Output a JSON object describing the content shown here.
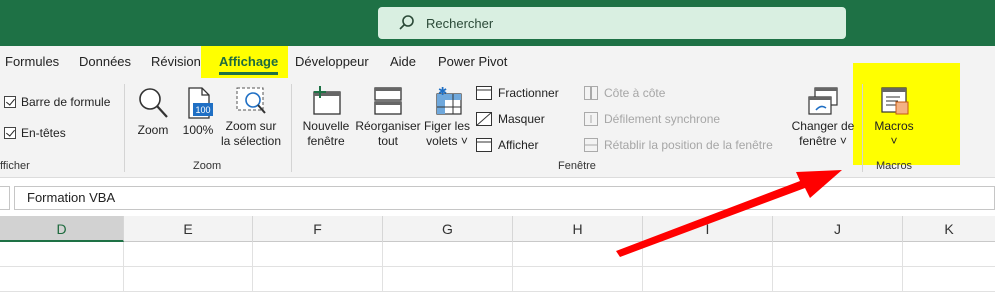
{
  "search": {
    "placeholder": "Rechercher"
  },
  "tabs": [
    {
      "label": "Formules"
    },
    {
      "label": "Données"
    },
    {
      "label": "Révision"
    },
    {
      "label": "Affichage"
    },
    {
      "label": "Développeur"
    },
    {
      "label": "Aide"
    },
    {
      "label": "Power Pivot"
    }
  ],
  "groups": {
    "show": {
      "label": "fficher",
      "formula_bar": "Barre de formule",
      "headings": "En-têtes"
    },
    "zoom": {
      "label": "Zoom",
      "zoom_btn": "Zoom",
      "zoom100_btn": "100%",
      "zoom100_icon_text": "100",
      "zoom_sel_l1": "Zoom sur",
      "zoom_sel_l2": "la sélection"
    },
    "window": {
      "label": "Fenêtre",
      "new_l1": "Nouvelle",
      "new_l2": "fenêtre",
      "arrange_l1": "Réorganiser",
      "arrange_l2": "tout",
      "freeze_l1": "Figer les",
      "freeze_l2": "volets ˅",
      "split": "Fractionner",
      "hide": "Masquer",
      "unhide": "Afficher",
      "side_by_side": "Côte à côte",
      "sync_scroll": "Défilement synchrone",
      "reset_pos": "Rétablir la position de la fenêtre",
      "switch_l1": "Changer de",
      "switch_l2": "fenêtre ˅"
    },
    "macros": {
      "label": "Macros",
      "macros_btn": "Macros",
      "dropdown": "˅"
    }
  },
  "formula_bar": {
    "value": "Formation VBA"
  },
  "columns": [
    "D",
    "E",
    "F",
    "G",
    "H",
    "I",
    "J",
    "K"
  ],
  "selected_column": "D",
  "colors": {
    "accent": "#1e7145",
    "highlight": "#ffff00",
    "arrow": "#ff0000"
  }
}
